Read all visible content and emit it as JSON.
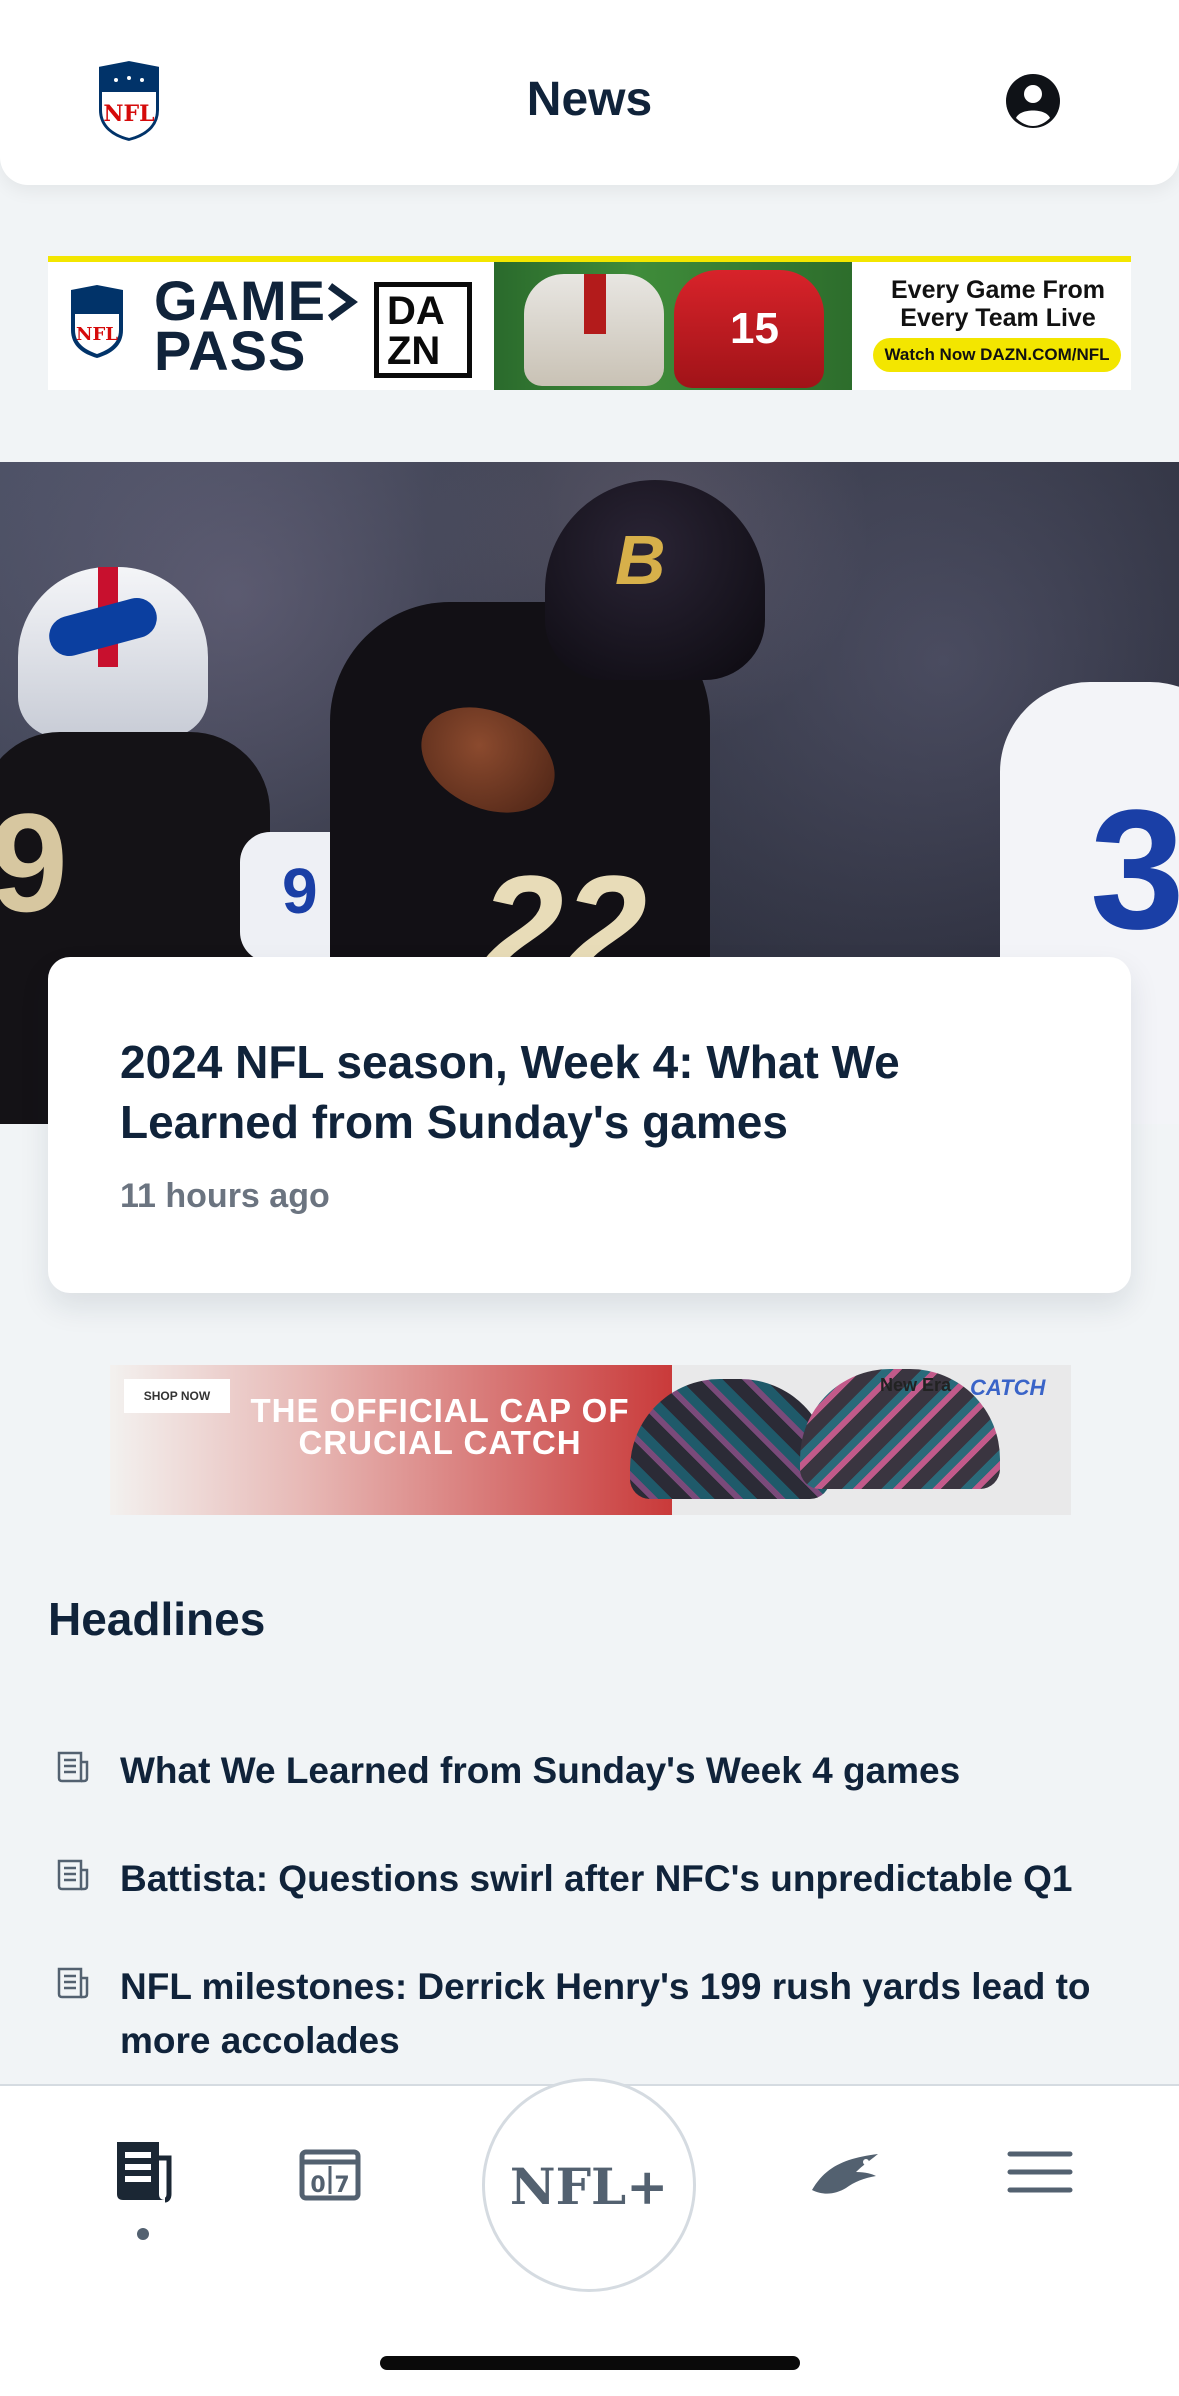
{
  "header": {
    "title": "News",
    "logo_text": "NFL"
  },
  "ad_top": {
    "brand_line1": "GAME",
    "brand_line2": "PASS",
    "partner": "DAZN",
    "partner_top": "DA",
    "partner_bottom": "ZN",
    "player_number": "15",
    "copy": "Every Game From Every Team Live",
    "cta": "Watch Now DAZN.COM/NFL"
  },
  "hero": {
    "title": "2024 NFL season, Week 4: What We Learned from Sunday's games",
    "time": "11 hours ago",
    "jersey_number": "22",
    "left_jersey": "9",
    "right_jersey": "3",
    "mid_jersey": "9",
    "helmet_logo": "B"
  },
  "ad_cap": {
    "shop_label": "SHOP NOW",
    "copy": "THE OFFICIAL CAP OF CRUCIAL CATCH",
    "brand": "New Era",
    "catch_label": "CATCH"
  },
  "headlines": {
    "title": "Headlines",
    "items": [
      {
        "text": "What We Learned from Sunday's Week 4 games"
      },
      {
        "text": "Battista: Questions swirl after NFC's unpredictable Q1"
      },
      {
        "text": "NFL milestones: Derrick Henry's 199 rush yards lead to more accolades"
      }
    ]
  },
  "bottom_nav": {
    "nfl_plus_label": "NFL+",
    "items": [
      "news-icon",
      "scores-icon",
      "nfl-plus-icon",
      "team-eagles-icon",
      "menu-icon"
    ],
    "active_index": 0
  },
  "colors": {
    "navy": "#10233a",
    "background": "#f1f4f6",
    "accent_yellow": "#f3e600",
    "nav_gray": "#536170"
  }
}
